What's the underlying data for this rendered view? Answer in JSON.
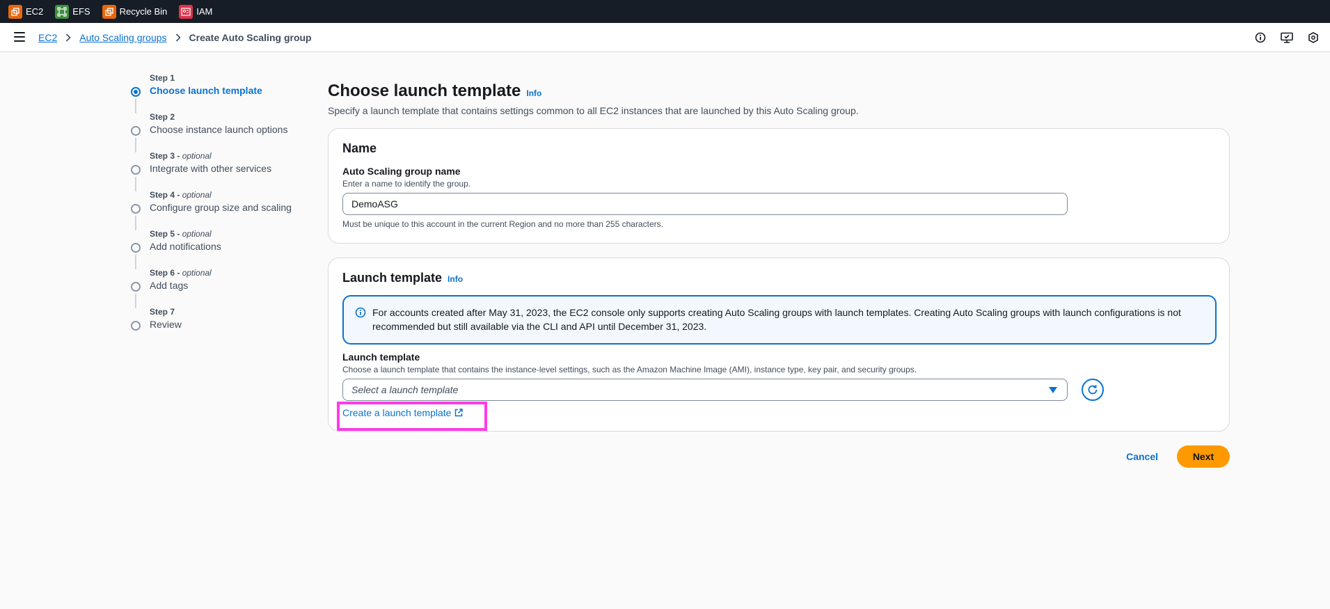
{
  "topbar": {
    "services": [
      {
        "label": "EC2",
        "icon": "ec2-icon",
        "color": "#e7670e"
      },
      {
        "label": "EFS",
        "icon": "efs-icon",
        "color": "#3e8f3e"
      },
      {
        "label": "Recycle Bin",
        "icon": "recycle-bin-icon",
        "color": "#e7670e"
      },
      {
        "label": "IAM",
        "icon": "iam-icon",
        "color": "#dd344c"
      }
    ]
  },
  "breadcrumb": {
    "items": [
      "EC2",
      "Auto Scaling groups"
    ],
    "current": "Create Auto Scaling group"
  },
  "steps": [
    {
      "num": "Step 1",
      "optional": "",
      "title": "Choose launch template",
      "active": true
    },
    {
      "num": "Step 2",
      "optional": "",
      "title": "Choose instance launch options",
      "active": false
    },
    {
      "num": "Step 3 - ",
      "optional": "optional",
      "title": "Integrate with other services",
      "active": false
    },
    {
      "num": "Step 4 - ",
      "optional": "optional",
      "title": "Configure group size and scaling",
      "active": false
    },
    {
      "num": "Step 5 - ",
      "optional": "optional",
      "title": "Add notifications",
      "active": false
    },
    {
      "num": "Step 6 - ",
      "optional": "optional",
      "title": "Add tags",
      "active": false
    },
    {
      "num": "Step 7",
      "optional": "",
      "title": "Review",
      "active": false
    }
  ],
  "page": {
    "title": "Choose launch template",
    "info": "Info",
    "description": "Specify a launch template that contains settings common to all EC2 instances that are launched by this Auto Scaling group."
  },
  "name_section": {
    "title": "Name",
    "label": "Auto Scaling group name",
    "description": "Enter a name to identify the group.",
    "value": "DemoASG",
    "constraint": "Must be unique to this account in the current Region and no more than 255 characters."
  },
  "launch_template_section": {
    "title": "Launch template",
    "info": "Info",
    "alert": "For accounts created after May 31, 2023, the EC2 console only supports creating Auto Scaling groups with launch templates. Creating Auto Scaling groups with launch configurations is not recommended but still available via the CLI and API until December 31, 2023.",
    "label": "Launch template",
    "description": "Choose a launch template that contains the instance-level settings, such as the Amazon Machine Image (AMI), instance type, key pair, and security groups.",
    "placeholder": "Select a launch template",
    "create_link": "Create a launch template"
  },
  "actions": {
    "cancel": "Cancel",
    "next": "Next"
  },
  "colors": {
    "accent": "#0972d3",
    "primary_button": "#ff9900",
    "highlight": "#ff3be8"
  }
}
